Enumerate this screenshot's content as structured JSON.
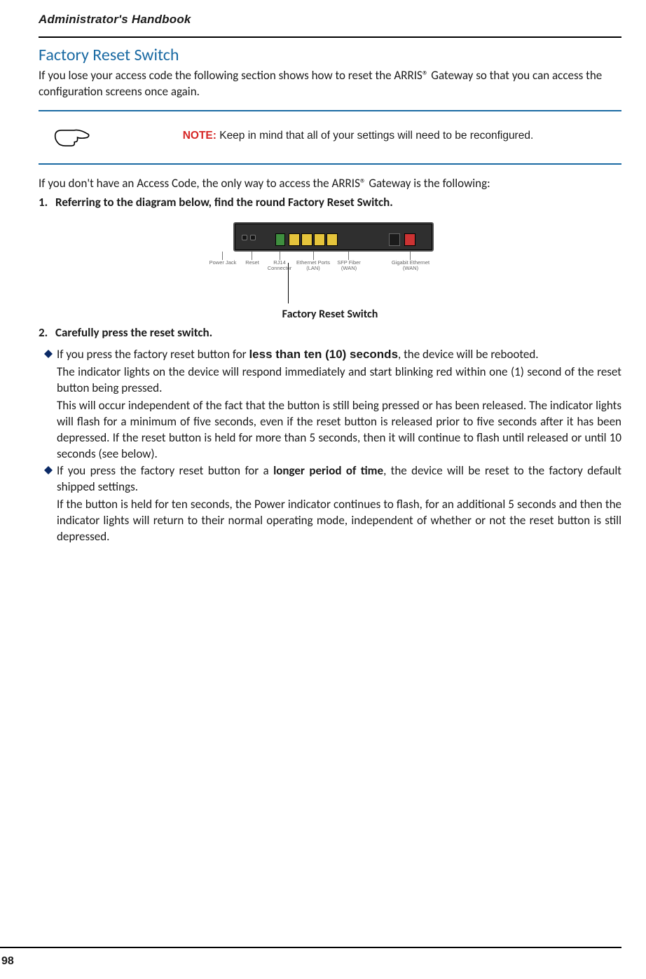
{
  "header": {
    "running_head": "Administrator's Handbook"
  },
  "section": {
    "title": "Factory Reset Switch",
    "intro": "If you lose your access code the following section shows how to reset the ARRIS® Gateway so that you can access the configuration screens once again."
  },
  "note": {
    "label": "NOTE:",
    "text": " Keep in mind that all of your settings will need to be reconfigured."
  },
  "lead_in": "If you don't have an Access Code, the only way to access the ARRIS® Gateway is the following:",
  "steps": {
    "s1_num": "1.",
    "s1_text": "Referring to the diagram below, find the round Factory Reset Switch.",
    "s2_num": "2.",
    "s2_text": "Carefully press the reset switch."
  },
  "diagram": {
    "labels": {
      "power": "Power Jack",
      "reset": "Reset",
      "rj14": "RJ14 Connector",
      "eth": "Ethernet Ports (LAN)",
      "sfp": "SFP Fiber (WAN)",
      "wan": "Gigabit Ethernet (WAN)"
    },
    "caption": "Factory Reset Switch"
  },
  "bullets": {
    "b1_lead": "If you press the factory reset button for ",
    "b1_bold": "less than ten (10) seconds",
    "b1_tail": ", the device will be rebooted.",
    "b1_p2": "The indicator lights on the device will respond immediately and start blinking red within one (1) second of the reset button being pressed.",
    "b1_p3": "This will occur independent of the fact that the button is still being pressed or has been released. The indicator lights will flash for a minimum of five seconds, even if the reset button is released prior to five seconds after it has been depressed. If the reset button is held for more than 5 seconds, then it will continue to flash until released or until 10 seconds (see below).",
    "b2_lead": "If you press the factory reset button for a ",
    "b2_bold": "longer period of time",
    "b2_tail": ", the device will be reset to the factory default shipped settings.",
    "b2_p2": "If the button is held for ten seconds, the Power indicator continues to flash, for an additional 5 seconds and then the indicator lights will return to their normal operating mode, independent of whether or not the reset button is still depressed."
  },
  "footer": {
    "page_number": "98"
  }
}
